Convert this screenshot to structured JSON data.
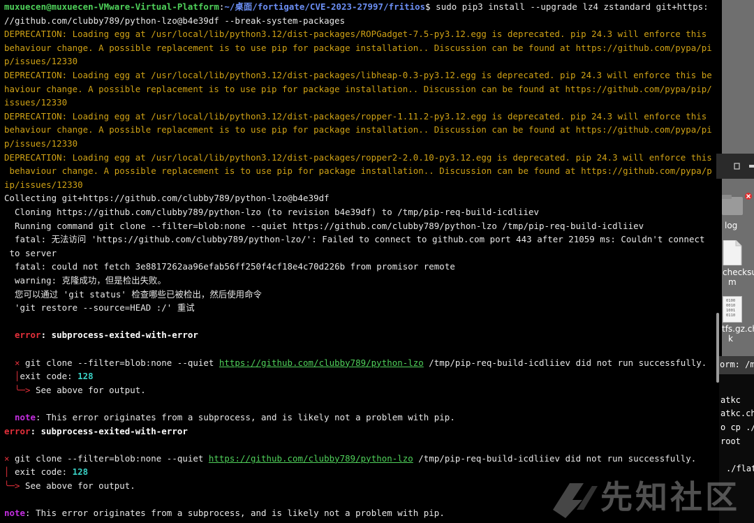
{
  "terminal": {
    "prompt_user": "muxuecen@muxuecen-VMware-Virtual-Platform",
    "prompt_path": "~/桌面/fortigate/CVE-2023-27997/fritios",
    "prompt_symbol": "$",
    "command_line1": " sudo pip3 install --upgrade lz4 zstandard git+https:",
    "command_line2": "//github.com/clubby789/python-lzo@b4e39df --break-system-packages",
    "deprecations": [
      "DEPRECATION: Loading egg at /usr/local/lib/python3.12/dist-packages/ROPGadget-7.5-py3.12.egg is deprecated. pip 24.3 will enforce this",
      "behaviour change. A possible replacement is to use pip for package installation.. Discussion can be found at https://github.com/pypa/pi",
      "p/issues/12330",
      "DEPRECATION: Loading egg at /usr/local/lib/python3.12/dist-packages/libheap-0.3-py3.12.egg is deprecated. pip 24.3 will enforce this be",
      "haviour change. A possible replacement is to use pip for package installation.. Discussion can be found at https://github.com/pypa/pip/",
      "issues/12330",
      "DEPRECATION: Loading egg at /usr/local/lib/python3.12/dist-packages/ropper-1.11.2-py3.12.egg is deprecated. pip 24.3 will enforce this",
      "behaviour change. A possible replacement is to use pip for package installation.. Discussion can be found at https://github.com/pypa/pi",
      "p/issues/12330",
      "DEPRECATION: Loading egg at /usr/local/lib/python3.12/dist-packages/ropper2-2.0.10-py3.12.egg is deprecated. pip 24.3 will enforce this",
      " behaviour change. A possible replacement is to use pip for package installation.. Discussion can be found at https://github.com/pypa/p",
      "ip/issues/12330"
    ],
    "output": [
      "Collecting git+https://github.com/clubby789/python-lzo@b4e39df",
      "  Cloning https://github.com/clubby789/python-lzo (to revision b4e39df) to /tmp/pip-req-build-icdliiev",
      "  Running command git clone --filter=blob:none --quiet https://github.com/clubby789/python-lzo /tmp/pip-req-build-icdliiev",
      "  fatal: 无法访问 'https://github.com/clubby789/python-lzo/': Failed to connect to github.com port 443 after 21059 ms: Couldn't connect",
      " to server",
      "  fatal: could not fetch 3e8817262aa96efab56ff250f4cf18e4c70d226b from promisor remote",
      "  warning: 克隆成功，但是检出失败。",
      "  您可以通过 'git status' 检查哪些已被检出，然后使用命令",
      "  'git restore --source=HEAD :/' 重试"
    ],
    "inner_error_label": "error",
    "error_text": ": subprocess-exited-with-error",
    "cross": "×",
    "git_clone_cmd": " git clone --filter=blob:none --quiet ",
    "repo_url": "https://github.com/clubby789/python-lzo",
    "git_clone_tail": " /tmp/pip-req-build-icdliiev did not run successfully.",
    "exit_code_label": "exit code: ",
    "exit_code_value": "128",
    "arrow": "╰─>",
    "see_above": " See above for output.",
    "note_label": "note",
    "note_text": ": This error originates from a subprocess, and is likely not a problem with pip."
  },
  "desktop": {
    "log_label": "log",
    "checksum_label_1": "checksu",
    "checksum_label_2": "m",
    "file_label_1": "tfs.gz.ch",
    "file_label_2": "k",
    "binary_icon_text": [
      "0100",
      "0010",
      "1001",
      "0110"
    ],
    "side_terminal": [
      "orm: /me",
      "atkc",
      "atkc.ch",
      "o cp ./",
      "root",
      "./flat"
    ],
    "watermark_text": "先知社区"
  }
}
